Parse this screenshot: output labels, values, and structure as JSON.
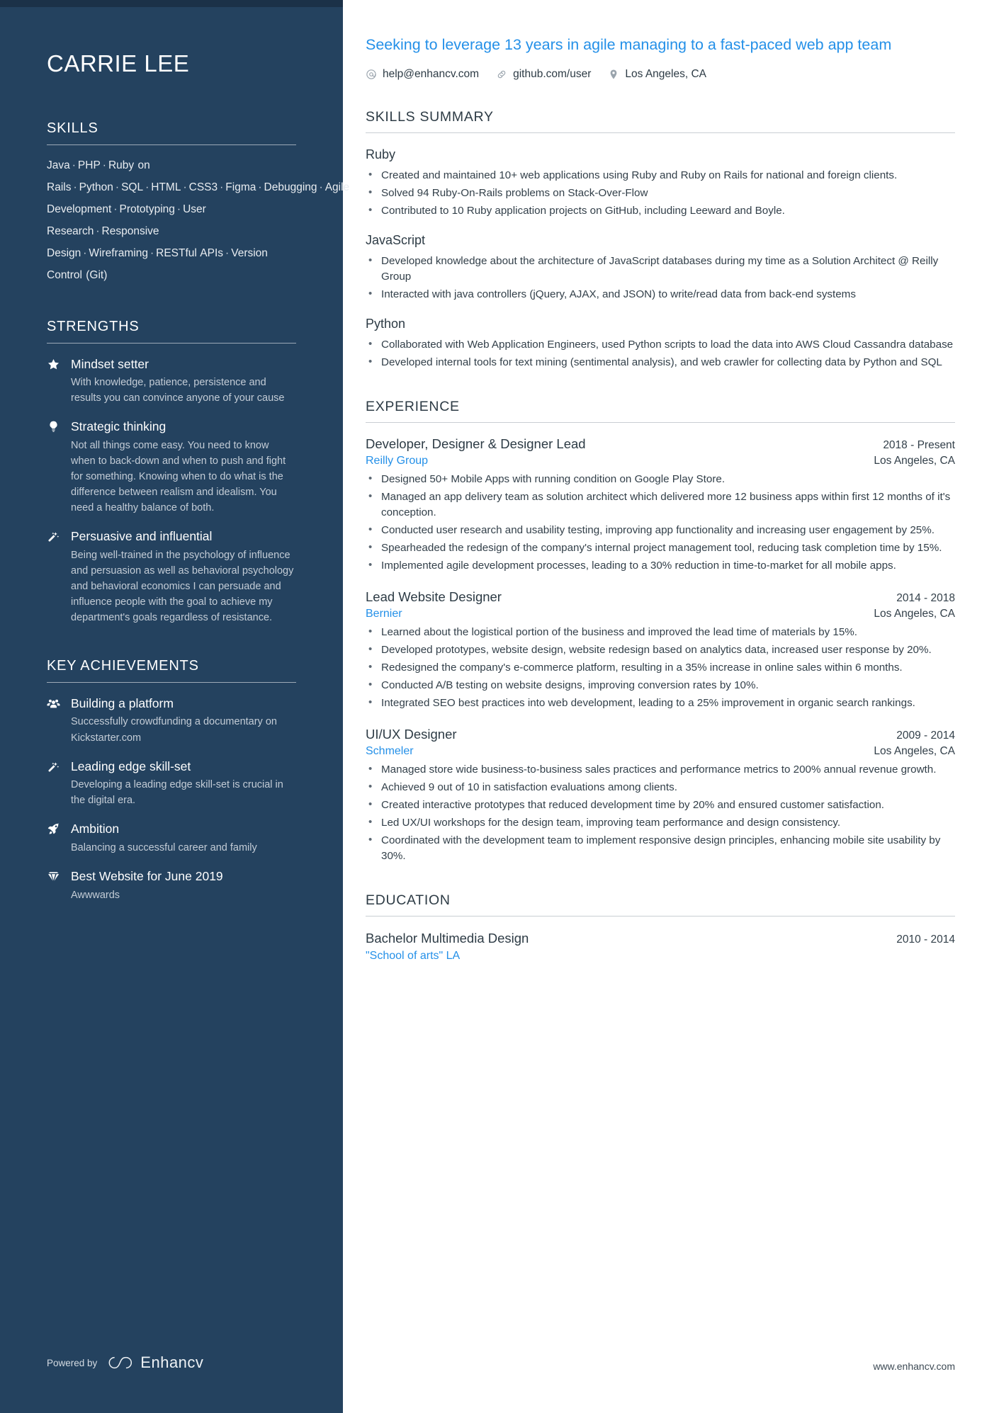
{
  "sidebar": {
    "name": "CARRIE LEE",
    "skills": {
      "heading": "SKILLS",
      "items": [
        "Java",
        "PHP",
        "Ruby on Rails",
        "Python",
        "SQL",
        "HTML",
        "CSS3",
        "Figma",
        "Debugging",
        "Agile Development",
        "Prototyping",
        "User Research",
        "Responsive Design",
        "Wireframing",
        "RESTful APIs",
        "Version Control (Git)"
      ]
    },
    "strengths": {
      "heading": "STRENGTHS",
      "items": [
        {
          "icon": "star-icon",
          "title": "Mindset setter",
          "desc": "With knowledge, patience, persistence and results you can convince anyone of your cause"
        },
        {
          "icon": "lightbulb-icon",
          "title": "Strategic thinking",
          "desc": "Not all things come easy. You need to know when to back-down and when to push and fight for something. Knowing when to do what is the difference between realism and idealism. You need a healthy balance of both."
        },
        {
          "icon": "magic-wand-icon",
          "title": "Persuasive and influential",
          "desc": "Being well-trained in the psychology of influence and persuasion as well as behavioral psychology and behavioral economics I can persuade and influence people with the goal to achieve my department's goals regardless of resistance."
        }
      ]
    },
    "achievements": {
      "heading": "KEY ACHIEVEMENTS",
      "items": [
        {
          "icon": "users-group-icon",
          "title": "Building a platform",
          "desc": "Successfully crowdfunding a documentary on Kickstarter.com"
        },
        {
          "icon": "magic-wand-icon",
          "title": "Leading edge skill-set",
          "desc": "Developing a leading edge skill-set is crucial in the digital era."
        },
        {
          "icon": "rocket-icon",
          "title": "Ambition",
          "desc": "Balancing a successful career and family"
        },
        {
          "icon": "diamond-icon",
          "title": "Best Website for June 2019",
          "desc": "Awwwards"
        }
      ]
    },
    "footer": {
      "powered_by": "Powered by",
      "brand": "Enhancv"
    }
  },
  "main": {
    "headline": "Seeking to leverage 13 years in agile managing to a fast-paced web app team",
    "contacts": [
      {
        "icon": "at-icon",
        "text": "help@enhancv.com"
      },
      {
        "icon": "link-icon",
        "text": "github.com/user"
      },
      {
        "icon": "map-pin-icon",
        "text": "Los Angeles, CA"
      }
    ],
    "skills_summary": {
      "heading": "SKILLS SUMMARY",
      "groups": [
        {
          "name": "Ruby",
          "bullets": [
            "Created and maintained 10+ web applications using Ruby and Ruby on Rails for national and foreign clients.",
            "Solved 94 Ruby-On-Rails problems on Stack-Over-Flow",
            "Contributed to 10 Ruby application projects on GitHub, including Leeward and Boyle."
          ]
        },
        {
          "name": "JavaScript",
          "bullets": [
            "Developed knowledge about the architecture of JavaScript databases during my time as a Solution Architect @ Reilly Group",
            "Interacted with java controllers (jQuery, AJAX, and JSON) to write/read data from back-end systems"
          ]
        },
        {
          "name": "Python",
          "bullets": [
            "Collaborated with Web Application Engineers, used Python scripts to load the data into AWS Cloud Cassandra database",
            "Developed internal tools for text mining (sentimental analysis), and web crawler for collecting data by Python and SQL"
          ]
        }
      ]
    },
    "experience": {
      "heading": "EXPERIENCE",
      "items": [
        {
          "role": "Developer, Designer & Designer Lead",
          "dates": "2018 - Present",
          "company": "Reilly Group",
          "location": "Los Angeles, CA",
          "bullets": [
            "Designed 50+ Mobile Apps with running condition on Google Play Store.",
            "Managed an app delivery team as solution architect which delivered more 12 business apps within first 12 months of it's conception.",
            "Conducted user research and usability testing, improving app functionality and increasing user engagement by 25%.",
            "Spearheaded the redesign of the company's internal project management tool, reducing task completion time by 15%.",
            "Implemented agile development processes, leading to a 30% reduction in time-to-market for all mobile apps."
          ]
        },
        {
          "role": "Lead Website Designer",
          "dates": "2014 - 2018",
          "company": "Bernier",
          "location": "Los Angeles, CA",
          "bullets": [
            "Learned about the logistical portion of the business and improved the lead time of materials by 15%.",
            "Developed prototypes, website design, website redesign based on analytics data, increased user response by 20%.",
            "Redesigned the company's e-commerce platform, resulting in a 35% increase in online sales within 6 months.",
            "Conducted A/B testing on website designs, improving conversion rates by 10%.",
            "Integrated SEO best practices into web development, leading to a 25% improvement in organic search rankings."
          ]
        },
        {
          "role": "UI/UX Designer",
          "dates": "2009 - 2014",
          "company": "Schmeler",
          "location": "Los Angeles, CA",
          "bullets": [
            "Managed store wide business-to-business sales practices and performance metrics to 200% annual revenue growth.",
            "Achieved 9 out of 10 in satisfaction evaluations among clients.",
            "Created interactive prototypes that reduced development time by 20% and ensured customer satisfaction.",
            "Led UX/UI workshops for the design team, improving team performance and design consistency.",
            "Coordinated with the development team to implement responsive design principles, enhancing mobile site usability by 30%."
          ]
        }
      ]
    },
    "education": {
      "heading": "EDUCATION",
      "items": [
        {
          "degree": "Bachelor Multimedia Design",
          "dates": "2010 - 2014",
          "school": "\"School of arts\" LA"
        }
      ]
    },
    "footer_url": "www.enhancv.com"
  },
  "colors": {
    "sidebar_bg": "#24425f",
    "sidebar_topbar": "#1b3148",
    "accent_blue": "#2490e8",
    "body_text": "#33404a"
  }
}
